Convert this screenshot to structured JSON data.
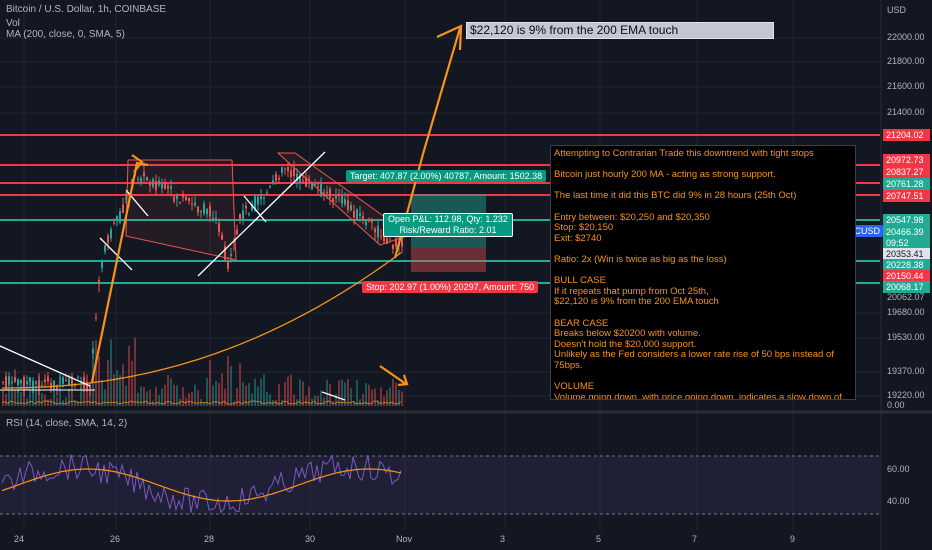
{
  "header": {
    "symbol_line": "Bitcoin / U.S. Dollar, 1h, COINBASE",
    "vol_label": "Vol",
    "ma_label": "MA (200, close, 0, SMA, 5)",
    "currency": "USD",
    "rsi_label": "RSI (14, close, SMA, 14, 2)"
  },
  "price_axis": {
    "ticks": [
      "22000.00",
      "21800.00",
      "21600.00",
      "21400.00",
      "19680.00",
      "19530.00",
      "19370.00",
      "19220.00",
      "0.00"
    ],
    "rsi_ticks": [
      "60.00",
      "40.00"
    ],
    "labels": {
      "p21204": "21204.02",
      "p20972": "20972.73",
      "p20837": "20837.27",
      "p20761": "20761.28",
      "p20747": "20747.51",
      "p20547": "20547.98",
      "symbol": "BTCUSD",
      "last": "20466.39",
      "timer": "09:52",
      "p20353": "20353.41",
      "p20228": "20228.38",
      "p20150": "20150.44",
      "p20068": "20068.17",
      "p20062": "20062.07"
    }
  },
  "time_axis": [
    "24",
    "26",
    "28",
    "30",
    "Nov",
    "3",
    "5",
    "7",
    "9"
  ],
  "tags": {
    "target": "Target: 407.87 (2.00%) 40787, Amount: 1502.38",
    "open_pl": "Open P&L: 112.98, Qty: 1.232",
    "rr": "Risk/Reward Ratio: 2.01",
    "stop": "Stop: 202.97 (1.00%) 20297, Amount: 750"
  },
  "target_box": "$22,120 is 9% from the 200 EMA touch",
  "annotation": {
    "p1": "Attempting to Contrarian Trade this downtrend with tight stops",
    "p2": "Bitcoin just hourly 200 MA - acting as strong support.",
    "p3": "The last time it did this BTC did 9% in 28 hours (25th Oct)",
    "p4": "Entry between: $20,250 and $20,350\nStop: $20,150\nExit: $2740",
    "p5": "Ratio: 2x (Win is twice as big as the loss)",
    "p6": "BULL CASE\nIf it repeats that pump from Oct 25th,\n$22,120 is 9% from the 200 EMA touch",
    "p7": "BEAR CASE\nBreaks below $20200 with volume.\nDoesn't hold the $20,000 support.\nUnlikely as the Fed considers a lower rate rise of 50 bps instead of 75bps.",
    "p8": "VOLUME\nVolume going down, with price going down, indicates a slow down of sellers and is bullish. If the volume was increasing here that would be bearish."
  },
  "colors": {
    "background": "#131722",
    "up": "#26a69a",
    "down": "#ef5350",
    "hline_red": "#f23645",
    "hline_green": "#22ab94",
    "ma": "#f7931a",
    "annotation_text": "#f7931a",
    "rsi": "#7e57c2"
  }
}
